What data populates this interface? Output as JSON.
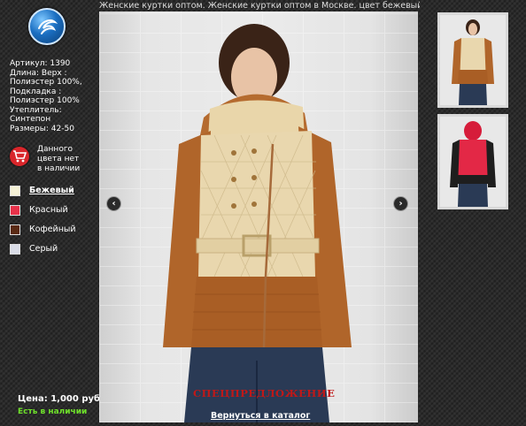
{
  "page": {
    "title": "Женские куртки оптом. Женские куртки оптом в Москве. цвет бежевый"
  },
  "product": {
    "details_lines": [
      "Артикул: 1390",
      "Длина: Верх :",
      "Полиэстер 100%,",
      "Подкладка :",
      "Полиэстер 100%",
      "Утеплитель:",
      "Синтепон",
      "Размеры: 42-50"
    ],
    "cart_notice_lines": [
      "Данного",
      "цвета нет",
      "в наличии"
    ],
    "price_label": "Цена:",
    "price_value": "1,000 руб.",
    "stock": "Есть в наличии",
    "special_offer": "СПЕЦПРЕДЛОЖЕНИЕ",
    "back_link": "Вернуться в каталог"
  },
  "colors": [
    {
      "label": "Бежевый",
      "swatch": "#f5f2d6",
      "active": true
    },
    {
      "label": "Красный",
      "swatch": "#e8324a",
      "active": false
    },
    {
      "label": "Кофейный",
      "swatch": "#5a2a14",
      "active": false
    },
    {
      "label": "Серый",
      "swatch": "#d9dce6",
      "active": false
    }
  ],
  "icons": {
    "logo": "logo-icon",
    "cart": "cart-icon",
    "prev": "chevron-left-icon",
    "next": "chevron-right-icon"
  },
  "accent_colors": {
    "stock_green": "#6ee02a",
    "special_red": "#c01818",
    "cart_red": "#d9262b"
  }
}
